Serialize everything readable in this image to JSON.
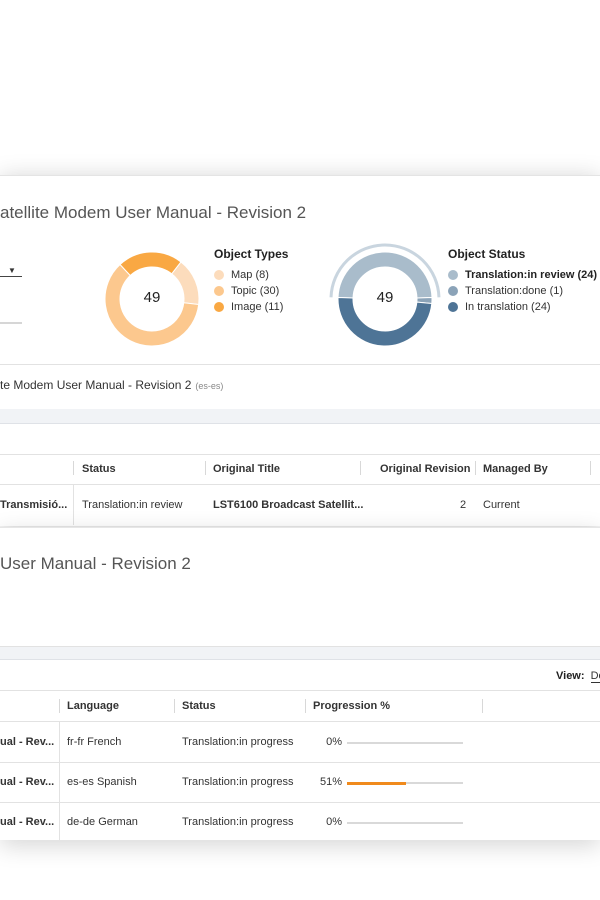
{
  "top": {
    "title": "atellite Modem User Manual - Revision 2",
    "object_types": {
      "title": "Object Types",
      "total": "49",
      "items": [
        {
          "label": "Map (8)",
          "value": 8,
          "color": "#fcdcbc"
        },
        {
          "label": "Topic (30)",
          "value": 30,
          "color": "#fcc88e"
        },
        {
          "label": "Image (11)",
          "value": 11,
          "color": "#f9a843"
        }
      ]
    },
    "object_status": {
      "title": "Object Status",
      "total": "49",
      "items": [
        {
          "label": "Translation:in review (24)",
          "value": 24,
          "color": "#a9bccb",
          "bold": true
        },
        {
          "label": "Translation:done (1)",
          "value": 1,
          "color": "#8ba3b8",
          "bold": false
        },
        {
          "label": "In translation (24)",
          "value": 24,
          "color": "#4e7496",
          "bold": false
        }
      ]
    },
    "breadcrumb": {
      "text": "te Modem User Manual - Revision 2",
      "tag": "(es-es)"
    },
    "table": {
      "headers": [
        "Status",
        "Original Title",
        "Original Revision",
        "Managed By"
      ],
      "row": {
        "name": "Transmisió...",
        "status": "Translation:in review",
        "original_title": "LST6100 Broadcast Satellit...",
        "original_revision": "2",
        "managed_by": "Current"
      }
    }
  },
  "bottom": {
    "title": "User Manual - Revision 2",
    "view_label": "View:",
    "view_value": "De",
    "headers": [
      "Language",
      "Status",
      "Progression %"
    ],
    "rows": [
      {
        "name": "ual - Rev...",
        "language": "fr-fr French",
        "status": "Translation:in progress",
        "progress_label": "0%",
        "progress": 0
      },
      {
        "name": "ual - Rev...",
        "language": "es-es Spanish",
        "status": "Translation:in progress",
        "progress_label": "51%",
        "progress": 51
      },
      {
        "name": "ual - Rev...",
        "language": "de-de German",
        "status": "Translation:in progress",
        "progress_label": "0%",
        "progress": 0
      }
    ]
  },
  "colors": {
    "accent_orange": "#f08a1c",
    "status_dark": "#4e7496"
  }
}
